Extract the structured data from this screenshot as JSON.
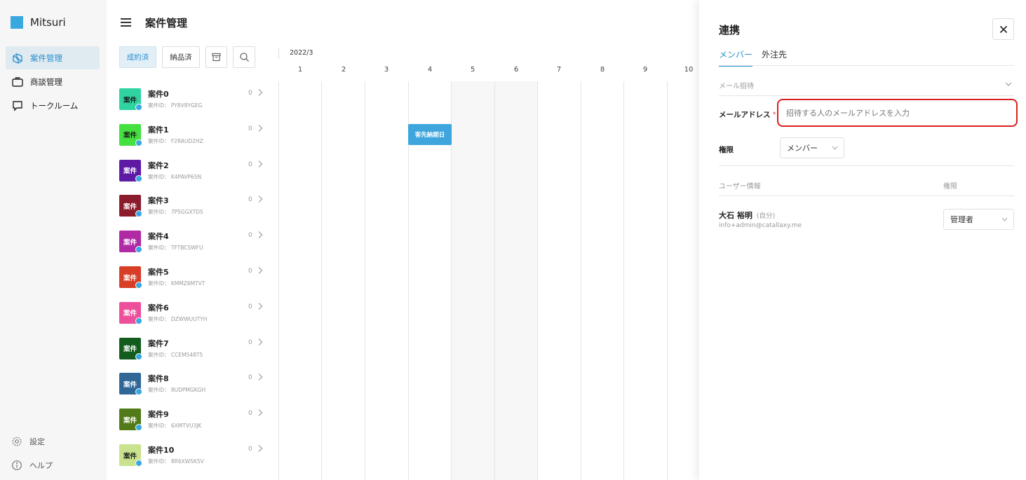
{
  "brand": {
    "name": "Mitsuri",
    "logo_color": "#3aa8e0"
  },
  "sidebar": {
    "items": [
      {
        "label": "案件管理",
        "icon": "projects-icon",
        "active": true
      },
      {
        "label": "商談管理",
        "icon": "briefcase-icon",
        "active": false
      },
      {
        "label": "トークルーム",
        "icon": "chat-icon",
        "active": false
      }
    ],
    "bottom": [
      {
        "label": "設定",
        "icon": "gear-icon"
      },
      {
        "label": "ヘルプ",
        "icon": "info-icon"
      }
    ]
  },
  "header": {
    "title": "案件管理"
  },
  "toolbar": {
    "contracted_label": "成約済",
    "delivered_label": "納品済",
    "archive_icon": "archive-icon",
    "search_icon": "search-icon"
  },
  "projects": [
    {
      "name": "案件0",
      "id": "案件ID： PY8V8YGEG",
      "count": "0",
      "badge": "案件",
      "color": "#2ed3a0"
    },
    {
      "name": "案件1",
      "id": "案件ID： F2RAUD2HZ",
      "count": "0",
      "badge": "案件",
      "color": "#43e03f"
    },
    {
      "name": "案件2",
      "id": "案件ID： K4PAVP65N",
      "count": "0",
      "badge": "案件",
      "color": "#5e1aa5"
    },
    {
      "name": "案件3",
      "id": "案件ID： 7P5GGXTDS",
      "count": "0",
      "badge": "案件",
      "color": "#8a1c2c"
    },
    {
      "name": "案件4",
      "id": "案件ID： TFTBCSWFU",
      "count": "0",
      "badge": "案件",
      "color": "#b02aa6"
    },
    {
      "name": "案件5",
      "id": "案件ID： KMMZ6MTVT",
      "count": "0",
      "badge": "案件",
      "color": "#d83d26"
    },
    {
      "name": "案件6",
      "id": "案件ID： DZWWUUTYH",
      "count": "0",
      "badge": "案件",
      "color": "#ee4f9b"
    },
    {
      "name": "案件7",
      "id": "案件ID： CCEM548T5",
      "count": "0",
      "badge": "案件",
      "color": "#135c1e"
    },
    {
      "name": "案件8",
      "id": "案件ID： 8UDPMGKGH",
      "count": "0",
      "badge": "案件",
      "color": "#2f6897"
    },
    {
      "name": "案件9",
      "id": "案件ID： 6XMTVU3JK",
      "count": "0",
      "badge": "案件",
      "color": "#527a18"
    },
    {
      "name": "案件10",
      "id": "案件ID： 8R6XWSK5V",
      "count": "0",
      "badge": "案件",
      "color": "#c8e28e"
    }
  ],
  "timeline": {
    "month": "2022/3",
    "days": [
      "1",
      "2",
      "3",
      "4",
      "5",
      "6",
      "7",
      "8",
      "9",
      "10"
    ],
    "event": {
      "label": "客先納期日",
      "color": "#3ea6dc"
    }
  },
  "panel": {
    "title": "連携",
    "tabs": [
      {
        "label": "メンバー",
        "active": true
      },
      {
        "label": "外注先",
        "active": false
      }
    ],
    "invite_section": "メール招待",
    "email_label": "メールアドレス",
    "required_mark": "*",
    "email_placeholder": "招待する人のメールアドレスを入力",
    "permission_label": "権限",
    "permission_value": "メンバー",
    "user_info_header": "ユーザー情報",
    "permission_header": "権限",
    "user": {
      "name": "大石 裕明",
      "self_tag": "(自分)",
      "email": "info+admin@catallaxy.me",
      "role": "管理者"
    }
  }
}
